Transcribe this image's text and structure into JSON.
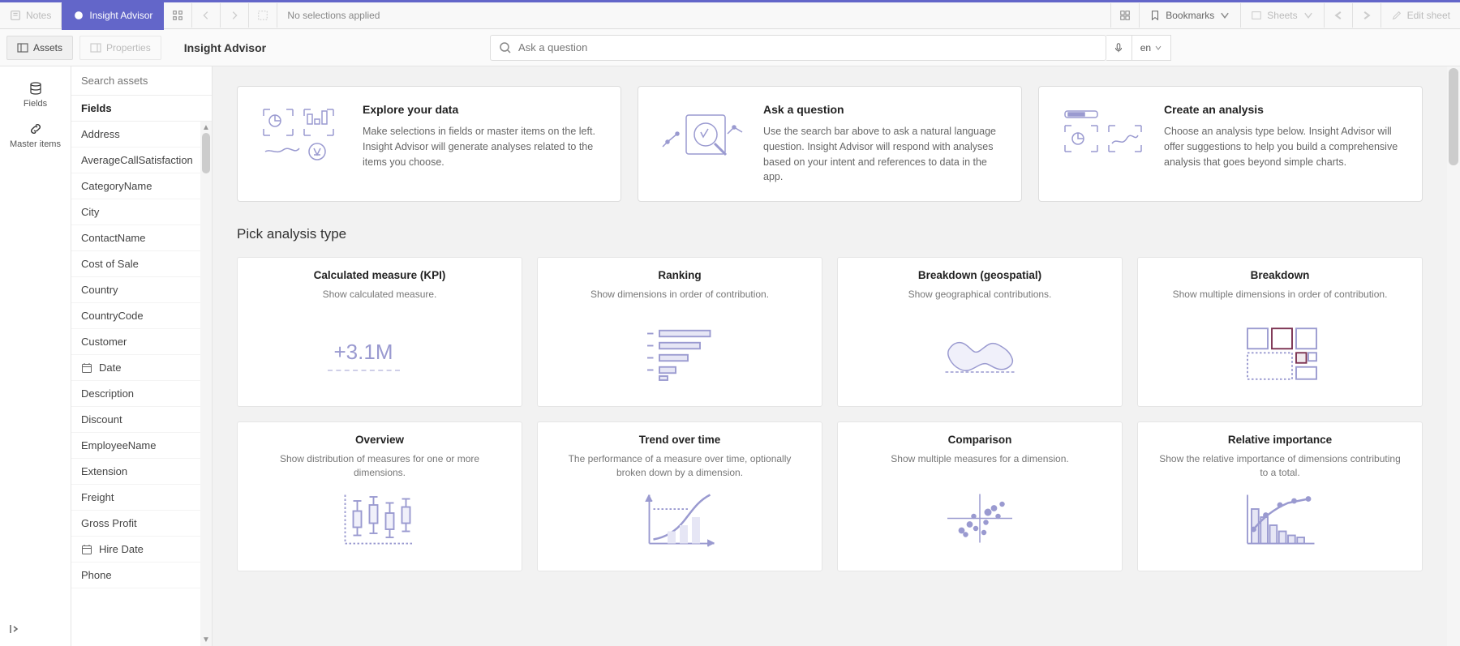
{
  "toolbar": {
    "notes": "Notes",
    "insight": "Insight Advisor",
    "selections": "No selections applied",
    "bookmarks": "Bookmarks",
    "sheets": "Sheets",
    "edit": "Edit sheet"
  },
  "subbar": {
    "assets": "Assets",
    "properties": "Properties",
    "title": "Insight Advisor",
    "search_placeholder": "Ask a question",
    "lang": "en"
  },
  "leftnav": {
    "fields": "Fields",
    "master": "Master items"
  },
  "fields": {
    "search_placeholder": "Search assets",
    "header": "Fields",
    "items": [
      {
        "label": "Address",
        "type": "text"
      },
      {
        "label": "AverageCallSatisfaction",
        "type": "text"
      },
      {
        "label": "CategoryName",
        "type": "text"
      },
      {
        "label": "City",
        "type": "text"
      },
      {
        "label": "ContactName",
        "type": "text"
      },
      {
        "label": "Cost of Sale",
        "type": "text"
      },
      {
        "label": "Country",
        "type": "text"
      },
      {
        "label": "CountryCode",
        "type": "text"
      },
      {
        "label": "Customer",
        "type": "text"
      },
      {
        "label": "Date",
        "type": "date"
      },
      {
        "label": "Description",
        "type": "text"
      },
      {
        "label": "Discount",
        "type": "text"
      },
      {
        "label": "EmployeeName",
        "type": "text"
      },
      {
        "label": "Extension",
        "type": "text"
      },
      {
        "label": "Freight",
        "type": "text"
      },
      {
        "label": "Gross Profit",
        "type": "text"
      },
      {
        "label": "Hire Date",
        "type": "date"
      },
      {
        "label": "Phone",
        "type": "text"
      }
    ]
  },
  "intro": [
    {
      "title": "Explore your data",
      "desc": "Make selections in fields or master items on the left. Insight Advisor will generate analyses related to the items you choose."
    },
    {
      "title": "Ask a question",
      "desc": "Use the search bar above to ask a natural language question. Insight Advisor will respond with analyses based on your intent and references to data in the app."
    },
    {
      "title": "Create an analysis",
      "desc": "Choose an analysis type below. Insight Advisor will offer suggestions to help you build a comprehensive analysis that goes beyond simple charts."
    }
  ],
  "sectionTitle": "Pick analysis type",
  "analysis": [
    {
      "title": "Calculated measure (KPI)",
      "desc": "Show calculated measure.",
      "viz": "kpi",
      "kpi": "+3.1M"
    },
    {
      "title": "Ranking",
      "desc": "Show dimensions in order of contribution.",
      "viz": "ranking"
    },
    {
      "title": "Breakdown (geospatial)",
      "desc": "Show geographical contributions.",
      "viz": "geo"
    },
    {
      "title": "Breakdown",
      "desc": "Show multiple dimensions in order of contribution.",
      "viz": "treemap"
    },
    {
      "title": "Overview",
      "desc": "Show distribution of measures for one or more dimensions.",
      "viz": "box"
    },
    {
      "title": "Trend over time",
      "desc": "The performance of a measure over time, optionally broken down by a dimension.",
      "viz": "trend"
    },
    {
      "title": "Comparison",
      "desc": "Show multiple measures for a dimension.",
      "viz": "scatter"
    },
    {
      "title": "Relative importance",
      "desc": "Show the relative importance of dimensions contributing to a total.",
      "viz": "pareto"
    }
  ]
}
